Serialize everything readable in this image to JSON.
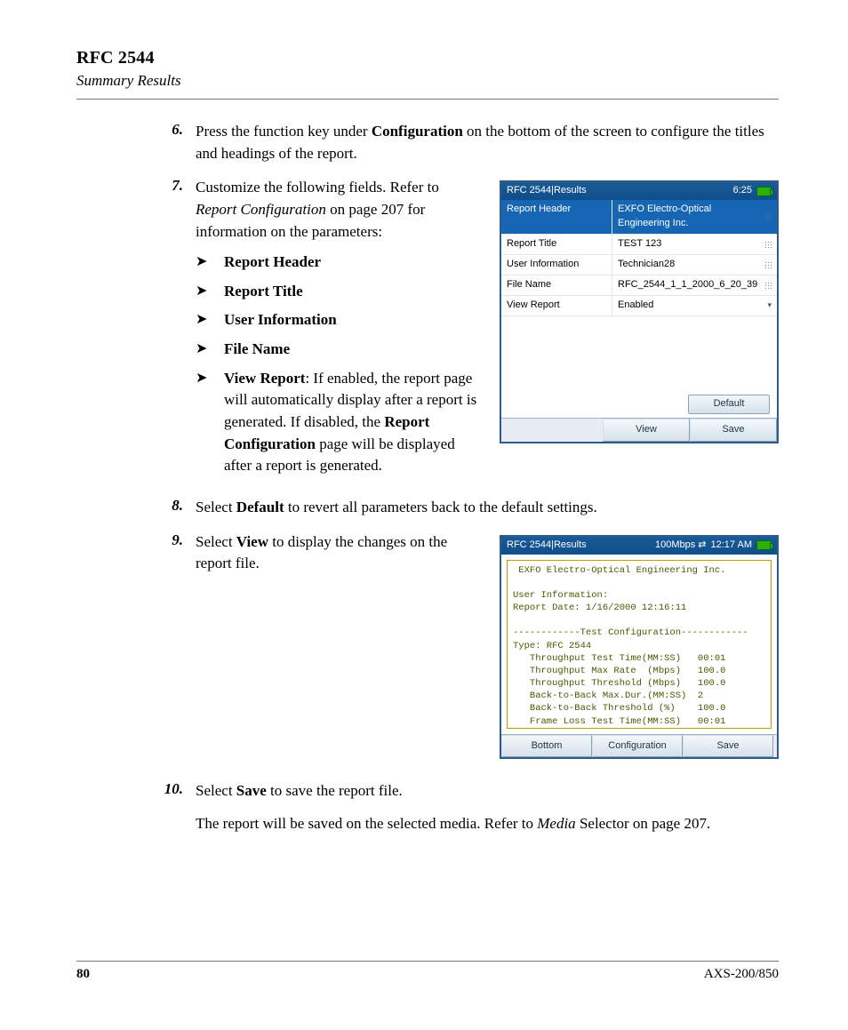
{
  "header": {
    "chapter": "RFC 2544",
    "section": "Summary Results"
  },
  "steps": {
    "s6": {
      "num": "6.",
      "pre": "Press the function key under ",
      "bold": "Configuration",
      "post": " on the bottom of the screen to configure the titles and headings of the report."
    },
    "s7": {
      "num": "7.",
      "line1_pre": "Customize the following fields. Refer to ",
      "line1_em": "Report Configuration",
      "line1_post": " on page 207 for information on the parameters:",
      "b1": "Report Header",
      "b2": "Report Title",
      "b3": "User Information",
      "b4": "File Name",
      "b5_lead": "View Report",
      "b5_mid": ": If enabled, the report page will automatically display after a report is generated. If disabled, the ",
      "b5_bold2": "Report Configuration",
      "b5_tail": " page will be displayed after a report is generated."
    },
    "s8": {
      "num": "8.",
      "pre": "Select ",
      "bold": "Default",
      "post": " to revert all parameters back to the default settings."
    },
    "s9": {
      "num": "9.",
      "pre": "Select ",
      "bold": "View",
      "post": " to display the changes on the report file."
    },
    "s10": {
      "num": "10.",
      "pre": "Select ",
      "bold": "Save",
      "post": " to save the report file.",
      "note_pre": "The report will be saved on the selected media. Refer to ",
      "note_em": "Media",
      "note_post": " Selector on page 207."
    }
  },
  "screen1": {
    "title": "RFC 2544|Results",
    "clock": "6:25",
    "rows": {
      "r1": {
        "label": "Report Header",
        "value": "EXFO Electro-Optical Engineering Inc."
      },
      "r2": {
        "label": "Report Title",
        "value": "TEST 123"
      },
      "r3": {
        "label": "User Information",
        "value": "Technician28"
      },
      "r4": {
        "label": "File Name",
        "value": "RFC_2544_1_1_2000_6_20_39"
      },
      "r5": {
        "label": "View Report",
        "value": "Enabled"
      }
    },
    "default_btn": "Default",
    "view_btn": "View",
    "save_btn": "Save"
  },
  "screen2": {
    "title": "RFC 2544|Results",
    "rate": "100Mbps",
    "clock": "12:17 AM",
    "report_text": " EXFO Electro-Optical Engineering Inc.\n\nUser Information:\nReport Date: 1/16/2000 12:16:11\n\n------------Test Configuration------------\nType: RFC 2544\n   Throughput Test Time(MM:SS)   00:01\n   Throughput Max Rate  (Mbps)   100.0\n   Throughput Threshold (Mbps)   100.0\n   Back-to-Back Max.Dur.(MM:SS)  2\n   Back-to-Back Threshold (%)    100.0\n   Frame Loss Test Time(MM:SS)   00:01",
    "bottom_btn": "Bottom",
    "config_btn": "Configuration",
    "save_btn": "Save"
  },
  "footer": {
    "page": "80",
    "model": "AXS-200/850"
  }
}
